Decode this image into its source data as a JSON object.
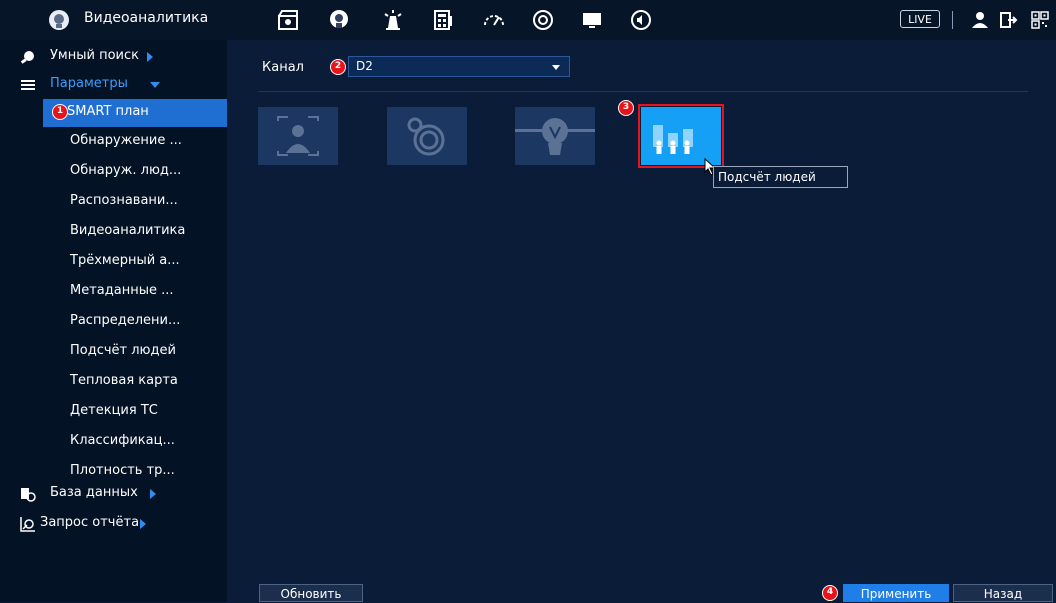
{
  "header": {
    "title": "Видеоаналитика",
    "live_label": "LIVE",
    "nav_icons": [
      "clapperboard-icon",
      "face-icon",
      "alarm-icon",
      "calculator-icon",
      "gauge-icon",
      "sync-icon",
      "monitor-icon",
      "speaker-icon"
    ]
  },
  "sidebar": {
    "smart_search": "Умный поиск",
    "params": "Параметры",
    "smart_plan": "SMART план",
    "sub_items": [
      "Обнаружение ...",
      "Обнаруж. люд...",
      "Распознавани...",
      "Видеоаналитика",
      "Трёхмерный а...",
      "Метаданные ...",
      "Распределени...",
      "Подсчёт людей",
      "Тепловая карта",
      "Детекция ТС",
      "Классификац...",
      "Плотность тр..."
    ],
    "database": "База данных",
    "report": "Запрос отчёта"
  },
  "main": {
    "channel_label": "Канал",
    "channel_value": "D2",
    "tooltip": "Подсчёт людей"
  },
  "badges": {
    "b1": "1",
    "b2": "2",
    "b3": "3",
    "b4": "4"
  },
  "buttons": {
    "refresh": "Обновить",
    "apply": "Применить",
    "back": "Назад"
  },
  "colors": {
    "accent": "#1f7ee8",
    "selected_tile": "#16a0f5",
    "badge": "#e8141b",
    "background": "#0b1c38"
  }
}
